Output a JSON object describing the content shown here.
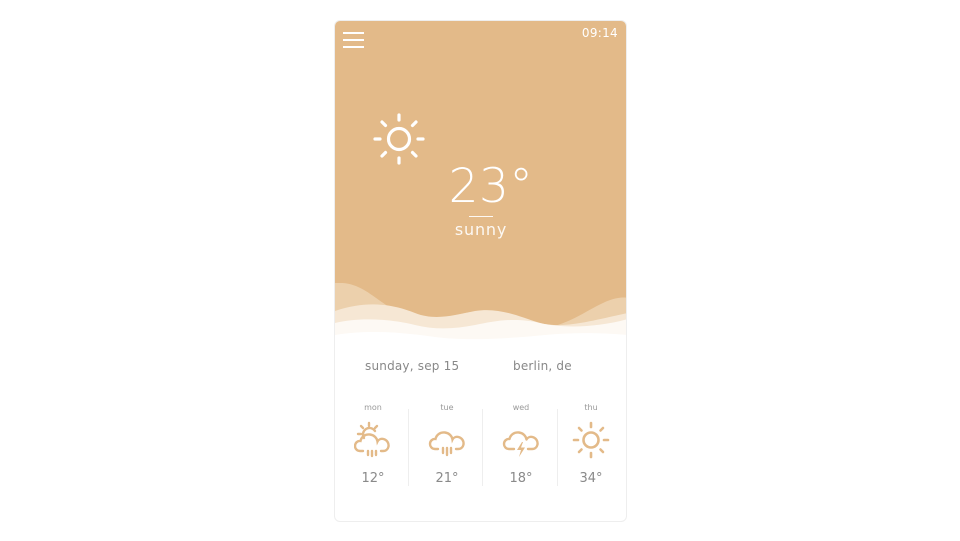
{
  "status_bar": {
    "time": "09:14",
    "menu_icon": "hamburger-menu-icon"
  },
  "current": {
    "icon": "sun-icon",
    "temperature": "23°",
    "condition": "sunny"
  },
  "info": {
    "date": "sunday, sep 15",
    "location": "berlin, de"
  },
  "forecast": [
    {
      "day": "mon",
      "icon": "sun-cloud-rain-icon",
      "temp": "12°"
    },
    {
      "day": "tue",
      "icon": "cloud-rain-icon",
      "temp": "21°"
    },
    {
      "day": "wed",
      "icon": "cloud-lightning-icon",
      "temp": "18°"
    },
    {
      "day": "thu",
      "icon": "sun-icon",
      "temp": "34°"
    }
  ],
  "colors": {
    "accent": "#e3ba89",
    "text_muted": "#888888",
    "background": "#ffffff"
  }
}
